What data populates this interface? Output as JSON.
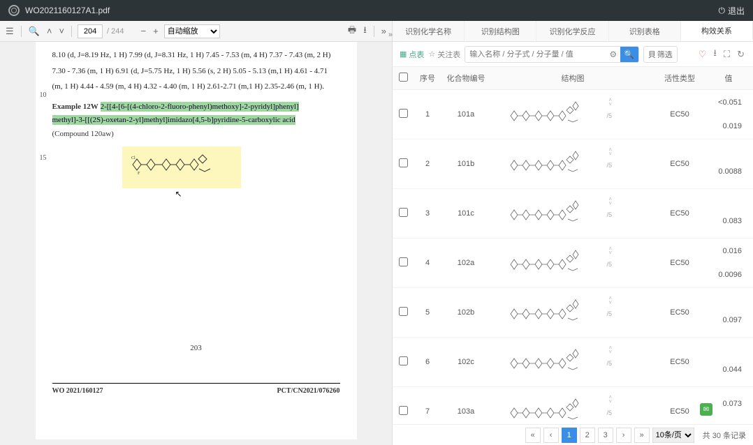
{
  "titlebar": {
    "filename": "WO2021160127A1.pdf",
    "logout": "退出"
  },
  "pdf_toolbar": {
    "page_current": "204",
    "page_total": "/ 244",
    "zoom_mode": "自动缩放"
  },
  "pdf_page": {
    "nmr1": "8.10 (d, J=8.19 Hz, 1 H) 7.99 (d, J=8.31 Hz, 1 H) 7.45 - 7.53 (m, 4 H) 7.37 - 7.43 (m, 2 H)",
    "nmr2": "7.30 - 7.36 (m, 1 H) 6.91 (d, J=5.75 Hz, 1 H) 5.56 (s, 2 H) 5.05 - 5.13 (m,1 H) 4.61 - 4.71",
    "nmr3": "(m, 1 H) 4.44 - 4.59 (m, 4 H) 4.32 - 4.40 (m, 1 H) 2.61-2.71 (m,1 H) 2.35-2.46 (m, 1 H).",
    "example_label": "Example 12W",
    "example_name1": "2-[[4-[6-[(4-chloro-2-fluoro-phenyl)methoxy]-2-pyridyl]phenyl]",
    "example_name2": "methyl]-3-[[(2S)-oxetan-2-yl]methyl]imidazo[4,5-b]pyridine-5-carboxylic acid",
    "compound": "(Compound 120aw)",
    "page_number": "203",
    "footer_left": "WO 2021/160127",
    "footer_right": "PCT/CN2021/076260",
    "line10": "10",
    "line15": "15"
  },
  "tabs": [
    "识别化学名称",
    "识别结构图",
    "识别化学反应",
    "识别表格",
    "构效关系"
  ],
  "toolbar2": {
    "dotview": "点表",
    "annotate": "关注表",
    "search_ph": "输入名称 / 分子式 / 分子量 / 值",
    "filter": "筛选"
  },
  "table": {
    "headers": {
      "idx": "序号",
      "cid": "化合物编号",
      "struct": "结构图",
      "activity": "活性类型",
      "value": "值"
    },
    "rows": [
      {
        "idx": "1",
        "cid": "101a",
        "act1": "EC50",
        "val1": "<0.051",
        "val2": "0.019"
      },
      {
        "idx": "2",
        "cid": "101b",
        "act1": "EC50",
        "val1": "",
        "val2": "0.0088"
      },
      {
        "idx": "3",
        "cid": "101c",
        "act1": "EC50",
        "val1": "",
        "val2": "0.083"
      },
      {
        "idx": "4",
        "cid": "102a",
        "act1": "EC50",
        "val1": "0.016",
        "val2": "0.0096"
      },
      {
        "idx": "5",
        "cid": "102b",
        "act1": "EC50",
        "val1": "",
        "val2": "0.097"
      },
      {
        "idx": "6",
        "cid": "102c",
        "act1": "EC50",
        "val1": "",
        "val2": "0.044"
      },
      {
        "idx": "7",
        "cid": "103a",
        "act1": "EC50",
        "val1": "0.073",
        "val2": ""
      }
    ],
    "sort_hint": "/5"
  },
  "pagination": {
    "pages": [
      "1",
      "2",
      "3"
    ],
    "per_page": "10条/页",
    "total": "共 30 条记录"
  }
}
